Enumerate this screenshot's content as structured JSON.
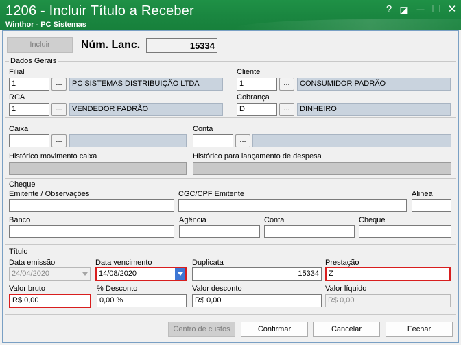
{
  "window": {
    "title": "1206 - Incluir Título a Receber",
    "subtitle": "Winthor - PC Sistemas",
    "help_glyph": "?",
    "restore_glyph": "◪",
    "minimize_glyph": "—",
    "maximize_glyph": "☐",
    "close_glyph": "✕",
    "accent_color": "#1a8640"
  },
  "header": {
    "include_label": "Incluir",
    "num_lanc_label": "Núm. Lanc.",
    "num_lanc_value": "15334"
  },
  "dados_gerais": {
    "group_label": "Dados Gerais",
    "filial_label": "Filial",
    "filial_code": "1",
    "filial_name": "PC SISTEMAS DISTRIBUIÇÃO LTDA",
    "cliente_label": "Cliente",
    "cliente_code": "1",
    "cliente_name": "CONSUMIDOR PADRÃO",
    "rca_label": "RCA",
    "rca_code": "1",
    "rca_name": "VENDEDOR PADRÃO",
    "cobranca_label": "Cobrança",
    "cobranca_code": "D",
    "cobranca_name": "DINHEIRO",
    "lookup_label": "..."
  },
  "caixa": {
    "caixa_label": "Caixa",
    "caixa_code": "",
    "conta_label": "Conta",
    "conta_code": "",
    "hist_caixa_label": "Histórico movimento caixa",
    "hist_despesa_label": "Histórico para lançamento de despesa"
  },
  "cheque": {
    "group_label": "Cheque",
    "emitente_label": "Emitente / Observações",
    "cgc_label": "CGC/CPF Emitente",
    "alinea_label": "Alinea",
    "banco_label": "Banco",
    "agencia_label": "Agência",
    "conta_label": "Conta",
    "cheque_label": "Cheque"
  },
  "titulo": {
    "group_label": "Título",
    "data_emissao_label": "Data emissão",
    "data_emissao_value": "24/04/2020",
    "data_vencimento_label": "Data vencimento",
    "data_vencimento_value": "14/08/2020",
    "duplicata_label": "Duplicata",
    "duplicata_value": "15334",
    "prestacao_label": "Prestação",
    "prestacao_value": "Z",
    "valor_bruto_label": "Valor bruto",
    "valor_bruto_value": "R$ 0,00",
    "desconto_pct_label": "% Desconto",
    "desconto_pct_value": "0,00 %",
    "valor_desconto_label": "Valor desconto",
    "valor_desconto_value": "R$ 0,00",
    "valor_liquido_label": "Valor líquido",
    "valor_liquido_value": "R$ 0,00"
  },
  "footer": {
    "centro_custos_label": "Centro de custos",
    "confirmar_label": "Confirmar",
    "cancelar_label": "Cancelar",
    "fechar_label": "Fechar"
  }
}
